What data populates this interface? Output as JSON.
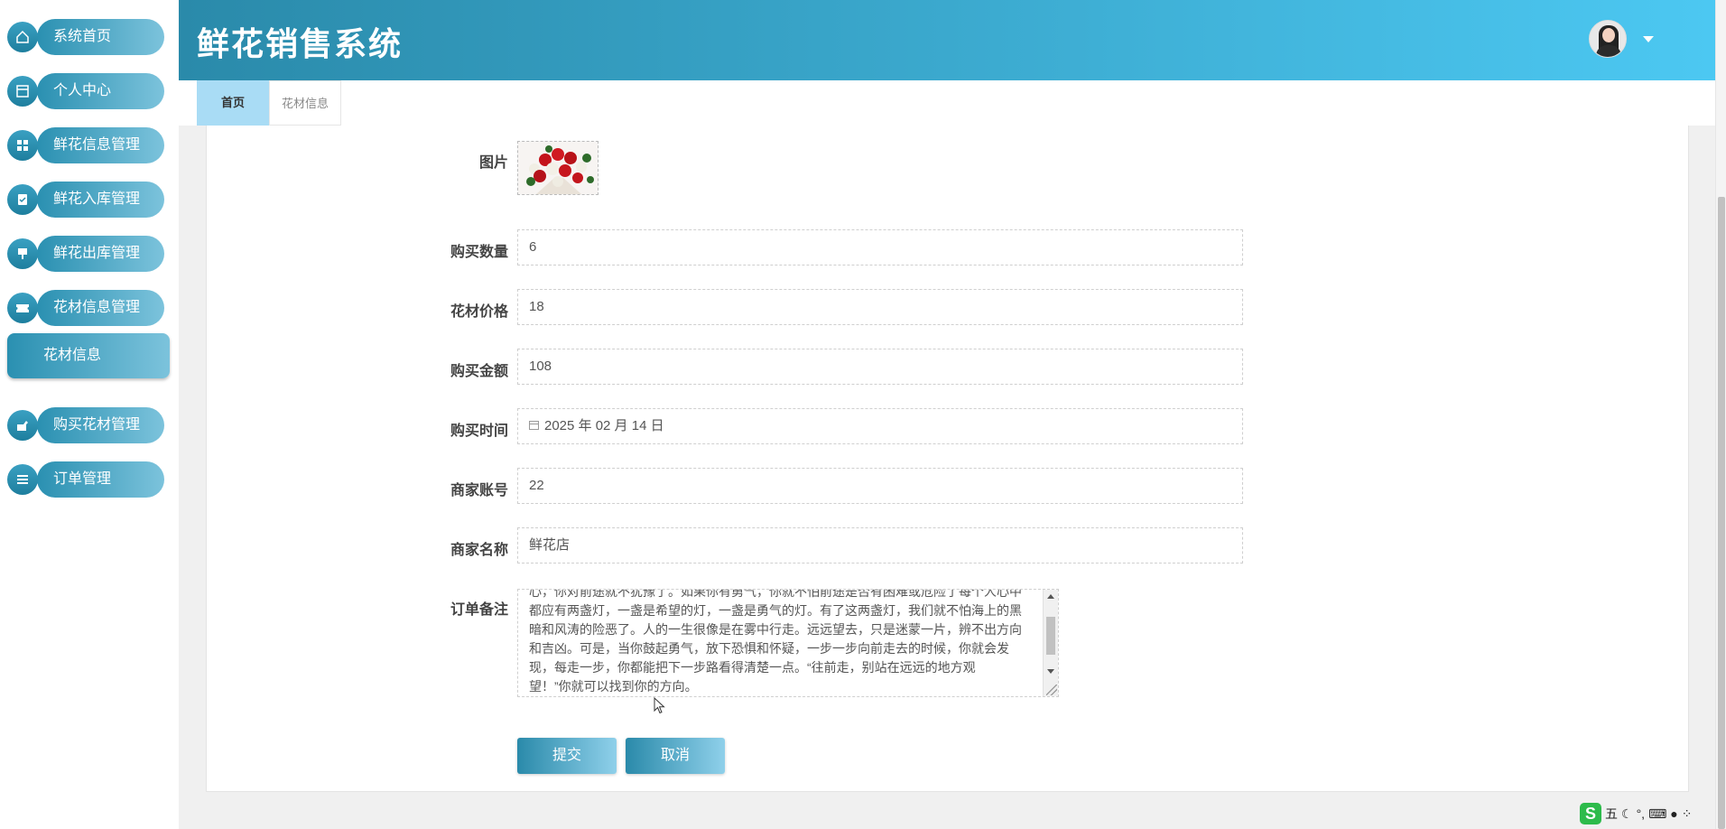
{
  "app": {
    "title": "鲜花销售系统"
  },
  "sidebar": {
    "items": [
      {
        "label": "系统首页",
        "icon": "home-icon"
      },
      {
        "label": "个人中心",
        "icon": "profile-card-icon"
      },
      {
        "label": "鲜花信息管理",
        "icon": "grid-icon"
      },
      {
        "label": "鲜花入库管理",
        "icon": "clipboard-icon"
      },
      {
        "label": "鲜花出库管理",
        "icon": "stamp-icon"
      },
      {
        "label": "花材信息管理",
        "icon": "ticket-icon"
      },
      {
        "label": "购买花材管理",
        "icon": "cart-icon"
      },
      {
        "label": "订单管理",
        "icon": "list-icon"
      }
    ],
    "active_sub": "花材信息"
  },
  "tabs": [
    {
      "label": "首页",
      "active": true
    },
    {
      "label": "花材信息",
      "active": false
    }
  ],
  "form": {
    "image_label": "图片",
    "quantity": {
      "label": "购买数量",
      "value": "6"
    },
    "price": {
      "label": "花材价格",
      "value": "18"
    },
    "amount": {
      "label": "购买金额",
      "value": "108"
    },
    "time": {
      "label": "购买时间",
      "value": "2025 年 02 月 14 日"
    },
    "merchant_account": {
      "label": "商家账号",
      "value": "22"
    },
    "merchant_name": {
      "label": "商家名称",
      "value": "鲜花店"
    },
    "note": {
      "label": "订单备注",
      "lines": [
        "心，你对前途就不犹豫了。如果你有勇气，你就不怕前途是否有困难或危险了每个人心中",
        "都应有两盏灯，一盏是希望的灯，一盏是勇气的灯。有了这两盏灯，我们就不怕海上的黑",
        "暗和风涛的险恶了。人的一生很像是在雾中行走。远远望去，只是迷蒙一片，辨不出方向",
        "和吉凶。可是，当你鼓起勇气，放下恐惧和怀疑，一步一步向前走去的时候，你就会发",
        "现，每走一步，你都能把下一步路看得清楚一点。“往前走，别站在远远的地方观",
        "望！”你就可以找到你的方向。"
      ]
    },
    "submit_label": "提交",
    "cancel_label": "取消"
  },
  "ime": {
    "logo": "S",
    "mode": "五"
  },
  "colors": {
    "header_start": "#2a8aaa",
    "header_end": "#4cc8f2",
    "tab_active": "#a9dcf5"
  }
}
